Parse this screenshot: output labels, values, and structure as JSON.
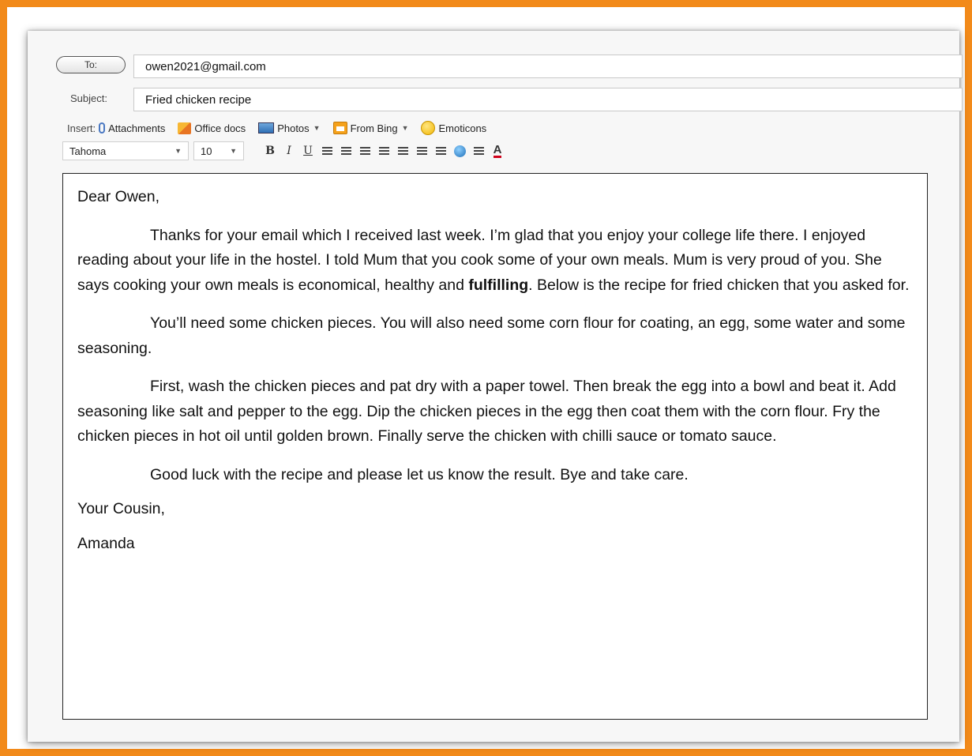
{
  "compose": {
    "to_button_label": "To:",
    "to_value": "owen2021@gmail.com",
    "subject_label": "Subject:",
    "subject_value": "Fried chicken recipe"
  },
  "insert_bar": {
    "label": "Insert:",
    "items": [
      {
        "label": "Attachments",
        "icon": "paperclip-icon"
      },
      {
        "label": "Office docs",
        "icon": "office-docs-icon"
      },
      {
        "label": "Photos",
        "icon": "photos-icon",
        "has_dropdown": true
      },
      {
        "label": "From Bing",
        "icon": "bing-icon",
        "has_dropdown": true
      },
      {
        "label": "Emoticons",
        "icon": "emoticon-icon"
      }
    ]
  },
  "format_toolbar": {
    "font_family": "Tahoma",
    "font_size": "10",
    "buttons": [
      "bold",
      "italic",
      "underline",
      "align-left",
      "align-center",
      "align-right",
      "numbered-list",
      "bulleted-list",
      "decrease-indent",
      "increase-indent",
      "insert-link",
      "text-direction",
      "font-color"
    ],
    "bold_glyph": "B",
    "italic_glyph": "I",
    "underline_glyph": "U",
    "font_color_glyph": "A"
  },
  "message": {
    "greeting": "Dear Owen,",
    "p1_before": "Thanks for your email which I received last week. I’m glad that you enjoy your college life there. I enjoyed reading about your life in the hostel. I told Mum that you cook some of your own meals. Mum is very proud of you. She says cooking your own meals is economical, healthy and ",
    "p1_bold": "fulfilling",
    "p1_after": ". Below is the recipe for fried chicken that you asked for.",
    "p2": "You’ll need some chicken pieces. You will also need some corn flour for coating, an egg, some water and some seasoning.",
    "p3": "First, wash the chicken pieces and pat dry with a paper towel. Then break the egg into a bowl and beat it. Add seasoning like salt and pepper to the egg. Dip the chicken pieces in the egg then coat them with the corn flour. Fry the chicken pieces in hot oil until golden brown. Finally serve the chicken with chilli sauce or tomato sauce.",
    "p4": "Good luck with the recipe and please let us know the result. Bye and take care.",
    "closing": "Your Cousin,",
    "signature": "Amanda"
  },
  "colors": {
    "frame_border": "#f28a1a",
    "font_color_underline": "#d0021b"
  }
}
